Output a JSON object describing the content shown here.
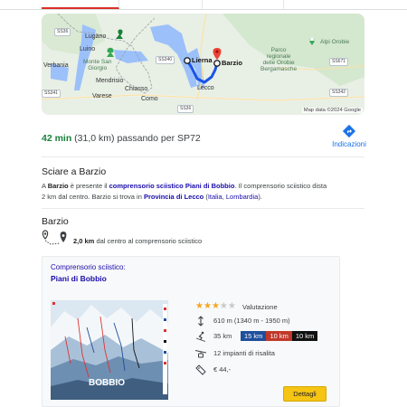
{
  "map": {
    "labels": {
      "lugano": "Lugano",
      "luino": "Luino",
      "monte_san_giorgio": "Monte San\nGiorgio",
      "verbania": "Verbania",
      "mendrisio": "Mendrisio",
      "chiasso": "Chiasso",
      "varese": "Varese",
      "como": "Como",
      "lierna": "Lierna",
      "barzio": "Barzio",
      "lecco": "Lecco",
      "parco": "Parco\nregionale\ndelle Orobie\nBergamasche",
      "alpi_orobie": "Alpi Orobie",
      "shield_ss36": "SS36",
      "shield_ss340": "SS340",
      "shield_ss341": "SS341",
      "shield_ss671": "SS671",
      "shield_ss342": "SS342",
      "shield_ss36b": "SS36"
    },
    "credit": "Map data ©2024 Google"
  },
  "route": {
    "time": "42 min",
    "details": " (31,0 km) passando per SP72"
  },
  "directions": {
    "label": "Indicazioni"
  },
  "ski_section": {
    "title": "Sciare a Barzio",
    "p1": "A ",
    "town": "Barzio",
    "p2": " è presente il ",
    "area_link": "comprensorio sciistico Piani di Bobbio",
    "p3": ". Il comprensorio sciistico dista 2 km dal centro. Barzio si trova in ",
    "province": "Provincia di Lecco",
    "p4": " (",
    "country": "Italia",
    "p5": ", ",
    "region": "Lombardia",
    "p6": ")."
  },
  "barzio": {
    "title": "Barzio",
    "distance": "2,0 km",
    "distance_text": " dal centro al comprensorio sciistico"
  },
  "card": {
    "type_label": "Comprensorio sciistico:",
    "name": "Piani di Bobbio",
    "rating_label": "Valutazione",
    "rating": 3,
    "rating_max": 5,
    "altitude": "610 m (1340 m - 1950 m)",
    "slopes_total": "35 km",
    "slopes": {
      "blue": "15 km",
      "red": "10 km",
      "black": "10 km"
    },
    "lifts": "12 impianti di risalita",
    "price": "€ 44,-",
    "details_button": "Dettagli",
    "trailmap_text": "BOBBIO"
  },
  "colors": {
    "time_green": "#188038",
    "link_blue": "#1a0dab",
    "accent_blue": "#1a73e8",
    "route_blue": "#1a53e8",
    "button_yellow": "#f6c413",
    "star": "#f5a623"
  }
}
